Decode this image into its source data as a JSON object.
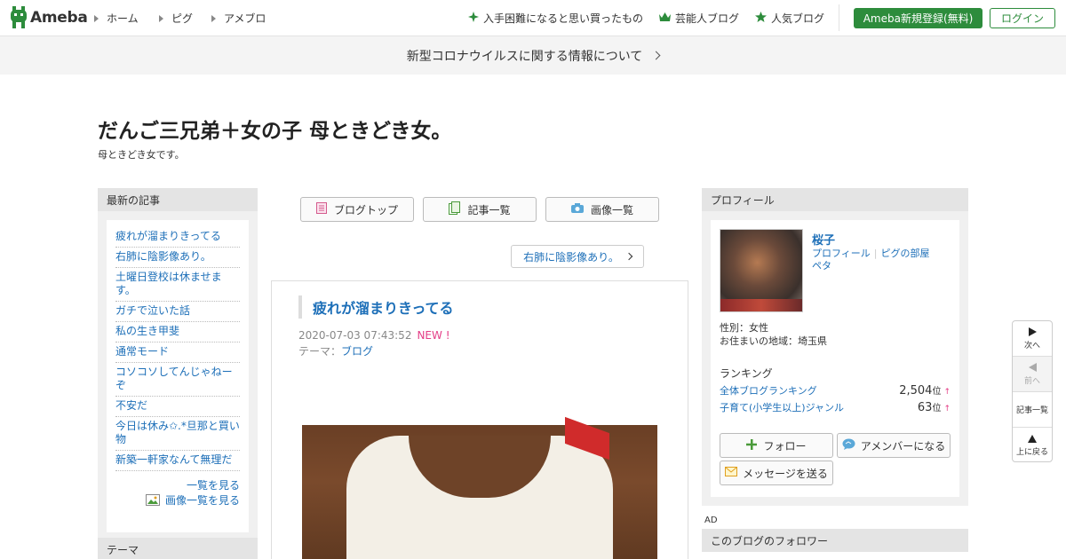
{
  "header": {
    "logo_text": "Ameba",
    "nav": [
      "ホーム",
      "ピグ",
      "アメブロ"
    ],
    "right_links": [
      {
        "label": "入手困難になると思い買ったもの",
        "icon": "sparkle-icon"
      },
      {
        "label": "芸能人ブログ",
        "icon": "crown-icon"
      },
      {
        "label": "人気ブログ",
        "icon": "star-icon"
      }
    ],
    "register_label": "Ameba新規登録(無料)",
    "login_label": "ログイン"
  },
  "notice": {
    "text": "新型コロナウイルスに関する情報について"
  },
  "blog": {
    "title": "だんご三兄弟＋女の子 母ときどき女。",
    "description": "母ときどき女です。"
  },
  "left": {
    "recent_heading": "最新の記事",
    "entries": [
      "疲れが溜まりきってる",
      "右肺に陰影像あり。",
      "土曜日登校は休ませます。",
      "ガチで泣いた話",
      "私の生き甲斐",
      "通常モード",
      "コソコソしてんじゃねーぞ",
      "不安だ",
      "今日は休み✩.*旦那と買い物",
      "新築一軒家なんて無理だ"
    ],
    "see_all": "一覧を見る",
    "see_images": "画像一覧を見る",
    "theme_heading": "テーマ"
  },
  "center": {
    "tabs": [
      "ブログトップ",
      "記事一覧",
      "画像一覧"
    ],
    "next_article": "右肺に陰影像あり。",
    "article": {
      "title": "疲れが溜まりきってる",
      "date": "2020-07-03 07:43:52",
      "new_badge": "NEW !",
      "theme_label": "テーマ：",
      "theme": "ブログ"
    }
  },
  "right": {
    "profile_heading": "プロフィール",
    "name": "桜子",
    "links": [
      "プロフィール",
      "ピグの部屋",
      "ペタ"
    ],
    "gender": "性別：女性",
    "location": "お住まいの地域：埼玉県",
    "ranking_heading": "ランキング",
    "rankings": [
      {
        "label": "全体ブログランキング",
        "value": "2,504",
        "unit": "位",
        "arrow": "↑"
      },
      {
        "label": "子育て(小学生以上)ジャンル",
        "value": "63",
        "unit": "位",
        "arrow": "↑"
      }
    ],
    "follow_label": "フォロー",
    "amember_label": "アメンバーになる",
    "message_label": "メッセージを送る",
    "ad_label": "AD",
    "followers_heading": "このブログのフォロワー"
  },
  "pager": {
    "next": "次へ",
    "prev": "前へ",
    "list": "記事一覧",
    "top": "上に戻る"
  },
  "colors": {
    "brand_green": "#2d8c3c",
    "link_blue": "#1d6fb8",
    "new_pink": "#e43d86"
  }
}
